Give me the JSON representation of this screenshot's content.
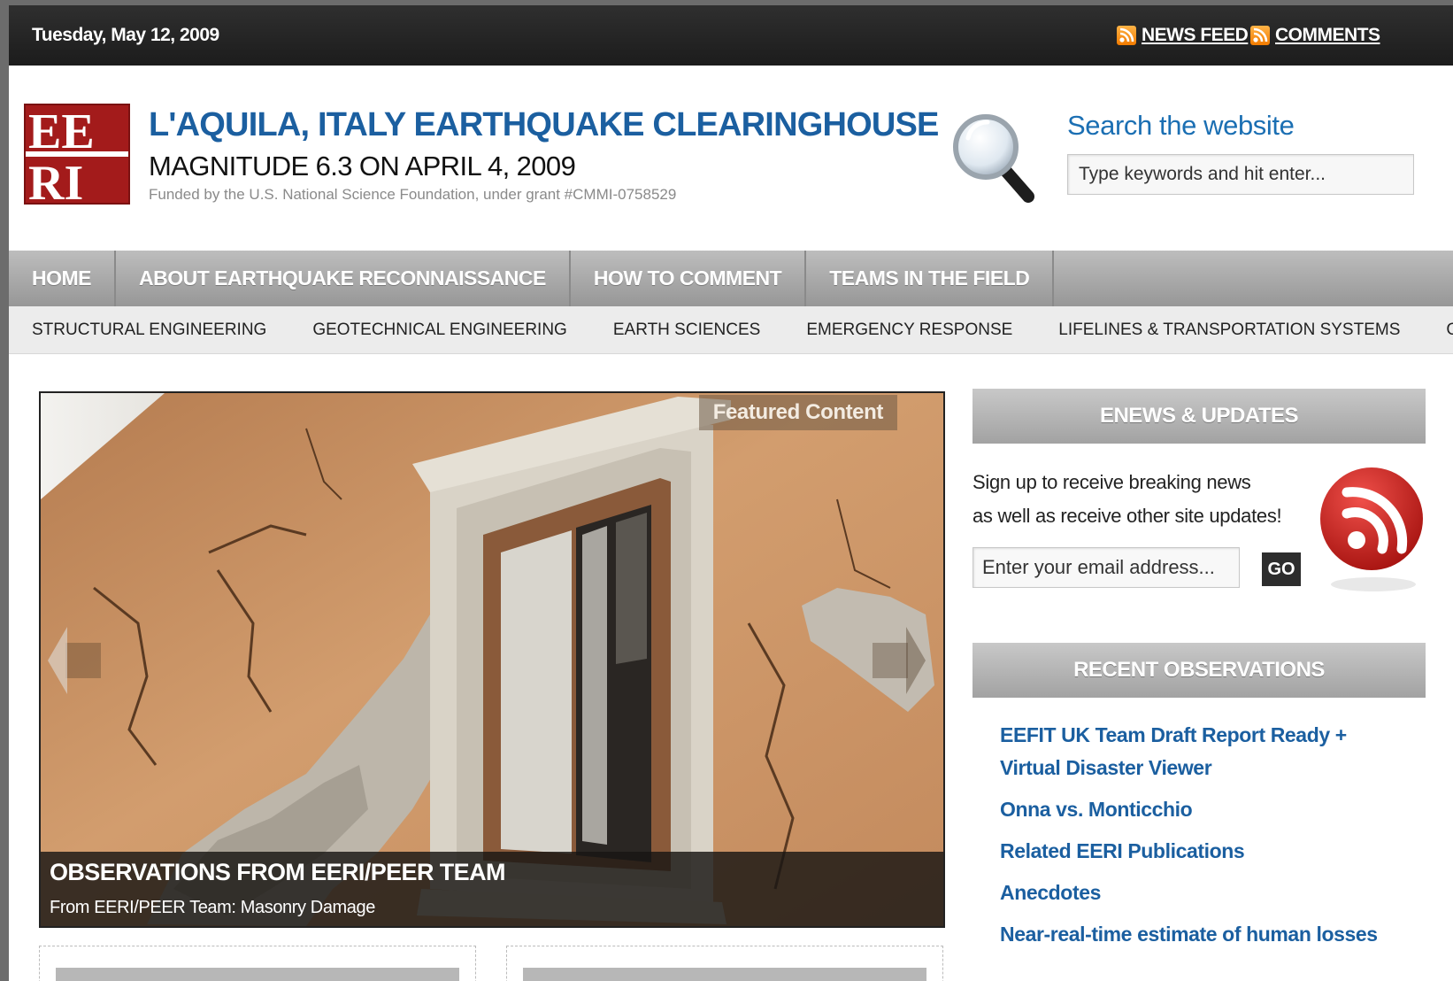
{
  "topbar": {
    "date": "Tuesday, May 12, 2009",
    "links": [
      {
        "label": "NEWS FEED",
        "icon": "rss-icon"
      },
      {
        "label": "COMMENTS",
        "icon": "rss-icon"
      }
    ]
  },
  "header": {
    "logo_text": "EERI",
    "title": "L'AQUILA, ITALY EARTHQUAKE CLEARINGHOUSE",
    "subtitle": "MAGNITUDE 6.3 ON APRIL 4, 2009",
    "funding": "Funded by the U.S. National Science Foundation, under grant #CMMI-0758529",
    "search": {
      "title": "Search the website",
      "placeholder": "Type keywords and hit enter..."
    }
  },
  "nav_primary": [
    "HOME",
    "ABOUT EARTHQUAKE RECONNAISSANCE",
    "HOW TO COMMENT",
    "TEAMS IN THE FIELD"
  ],
  "nav_secondary": [
    "STRUCTURAL ENGINEERING",
    "GEOTECHNICAL ENGINEERING",
    "EARTH SCIENCES",
    "EMERGENCY RESPONSE",
    "LIFELINES & TRANSPORTATION SYSTEMS",
    "GENERAL"
  ],
  "featured": {
    "tag": "Featured Content",
    "title": "OBSERVATIONS FROM EERI/PEER TEAM",
    "subtitle": "From EERI/PEER Team: Masonry Damage"
  },
  "sidebar": {
    "enews": {
      "heading": "ENEWS & UPDATES",
      "line1": "Sign up to receive breaking news",
      "line2": "as well as receive other site updates!",
      "email_placeholder": "Enter your email address...",
      "go_label": "GO"
    },
    "observations": {
      "heading": "RECENT OBSERVATIONS",
      "items": [
        "EEFIT UK Team Draft Report Ready + Virtual Disaster Viewer",
        "Onna vs. Monticchio",
        "Related EERI Publications",
        "Anecdotes",
        "Near-real-time estimate of human losses"
      ]
    }
  },
  "colors": {
    "topbar": "#222222",
    "title_blue": "#1b5fa0",
    "nav_gray": "#a8a8a8",
    "logo_red": "#a31b1b",
    "rss_orange": "#f27b00"
  }
}
